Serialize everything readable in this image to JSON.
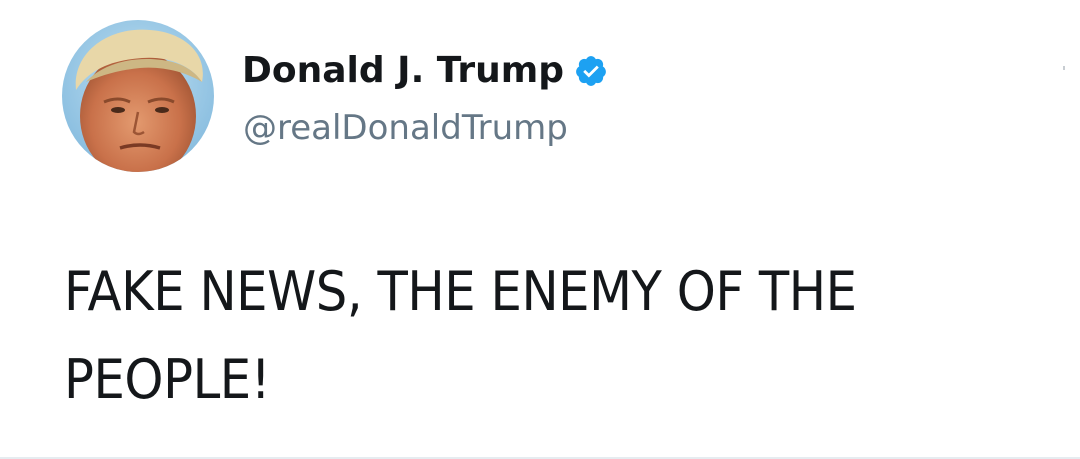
{
  "tweet": {
    "display_name": "Donald J. Trump",
    "verified_icon": "verified-badge-icon",
    "handle": "@realDonaldTrump",
    "text": "FAKE NEWS, THE ENEMY OF THE PEOPLE!"
  },
  "colors": {
    "verified_blue": "#1da1f2",
    "name_text": "#14171a",
    "handle_text": "#657786",
    "background": "#ffffff"
  }
}
